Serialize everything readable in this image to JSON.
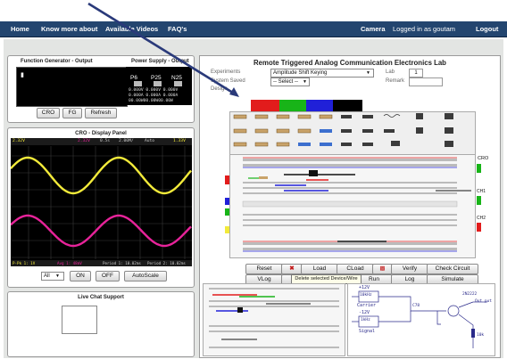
{
  "nav": {
    "home": "Home",
    "know_more": "Know more about",
    "available_videos": "Available Videos",
    "faqs": "FAQ's",
    "camera": "Camera",
    "logged_in": "Logged in as goutam",
    "logout": "Logout"
  },
  "fg_panel": {
    "title_left": "Function Generator - Output",
    "title_right": "Power Supply - Output",
    "ps_labels": [
      "P6",
      "P25",
      "N25"
    ],
    "ps_rows": [
      "0.000V 0.000V 0.000V",
      "0.000A 0.000A 0.000A",
      "00.00W00.00W00.00W"
    ],
    "buttons": [
      "CRO",
      "FG",
      "Refresh"
    ]
  },
  "cro_panel": {
    "title": "CRO - Display Panel",
    "top_readouts": [
      "2.32V",
      "2.32V",
      "0.5s",
      "2.00M/",
      "Auto",
      "1.33V"
    ],
    "bottom_readouts": [
      "P-Pk 1: 1V",
      "Avg 1: 48mV",
      "Period 1: 10.02ms",
      "Period 2: 10.02ms"
    ],
    "channel_select": "All",
    "buttons": [
      "ON",
      "OFF",
      "AutoScale"
    ]
  },
  "chat_panel": {
    "title": "Live Chat Support"
  },
  "lab": {
    "title": "Remote Triggered Analog Communication Electronics Lab",
    "experiments_label": "Experiments",
    "experiment_value": "Amplitude Shift Keying",
    "lab_label": "Lab",
    "lab_value": "1",
    "system_saved_label": "System Saved",
    "saved_select": "-- Select --",
    "design_label": "Design",
    "remark_label": "Remark",
    "colors": [
      "#e21c1c",
      "#18b418",
      "#2020d8",
      "#000000"
    ]
  },
  "components": {
    "row1": [
      "27 k",
      "10 k",
      "1 k",
      "1.8k",
      "220k",
      "4.7n",
      "D3",
      "2.7mH",
      "N",
      "op-amp"
    ],
    "row2": [
      "1k",
      "1k",
      "1.8k",
      "6.8k",
      "10n",
      "1n",
      "D1",
      "D4",
      "2N3906",
      "op-amp"
    ],
    "row3": [
      "10k",
      "10k",
      "2.7k",
      "3n",
      "100n",
      "22",
      "1n4007",
      "2N2222",
      "op-amp",
      "IC"
    ],
    "cro_label": "CRO",
    "channel_labels": [
      "CH1",
      "CH2"
    ]
  },
  "toolbar": {
    "row1": [
      "Reset",
      "Load",
      "CLoad",
      "Verify",
      "Check Circuit"
    ],
    "row2": [
      "VLog",
      "Run",
      "Log",
      "Simulate"
    ],
    "tooltip": "Delete selected Device/Wire"
  },
  "schematic": {
    "labels": [
      "+12V",
      "10kHz",
      "Carrier",
      "-12V",
      "1kHz",
      "Signal",
      "C78",
      "2N2222",
      "10k",
      "Out put"
    ]
  }
}
